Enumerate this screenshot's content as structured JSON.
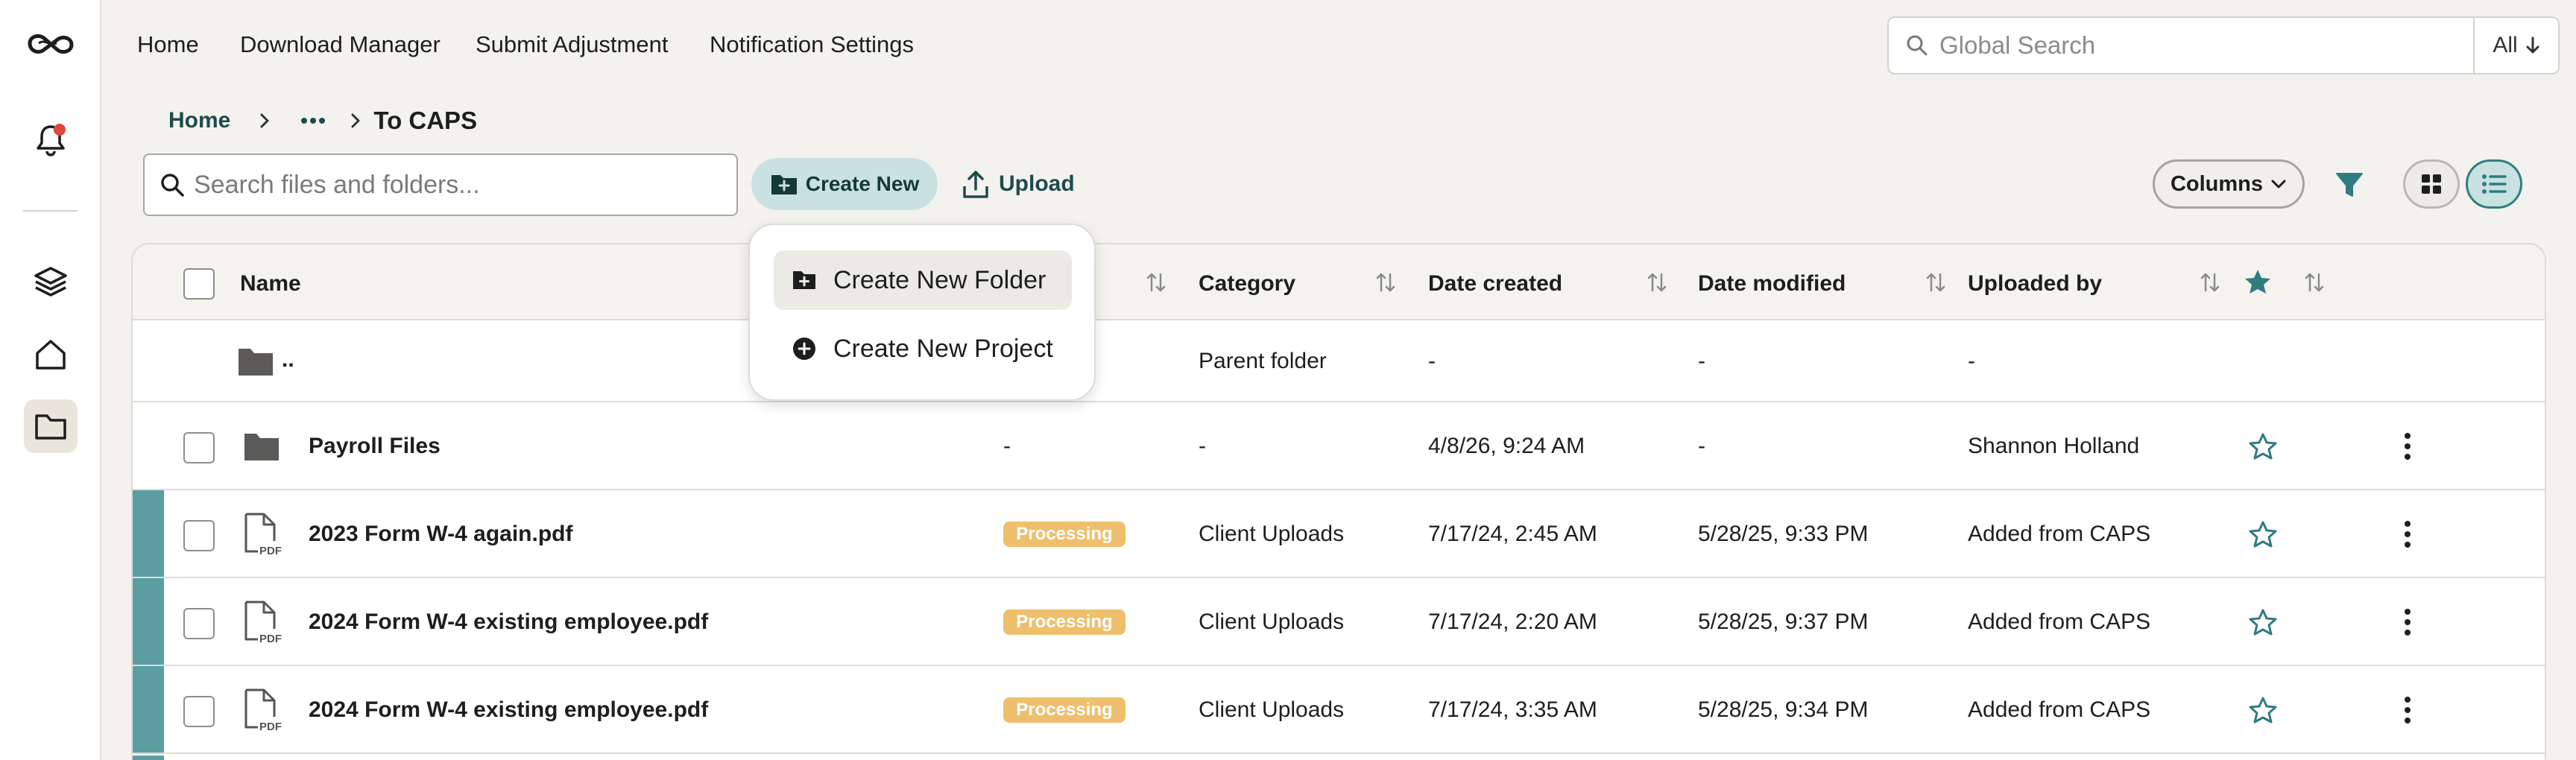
{
  "app": {
    "name": "CAPS"
  },
  "nav": {
    "items": [
      "Home",
      "Download Manager",
      "Submit Adjustment",
      "Notification Settings"
    ]
  },
  "global_search": {
    "placeholder": "Global Search",
    "scope": "All"
  },
  "breadcrumb": {
    "home": "Home",
    "current": "To CAPS"
  },
  "toolbar": {
    "search_placeholder": "Search files and folders...",
    "create_label": "Create New",
    "upload_label": "Upload",
    "columns_label": "Columns"
  },
  "create_menu": {
    "items": [
      "Create New Folder",
      "Create New Project"
    ]
  },
  "table": {
    "headers": {
      "name": "Name",
      "category": "Category",
      "created": "Date created",
      "modified": "Date modified",
      "uploaded_by": "Uploaded by"
    },
    "parent": {
      "name": "..",
      "category": "Parent folder",
      "created": "-",
      "modified": "-",
      "uploaded_by": "-"
    },
    "rows": [
      {
        "type": "folder",
        "name": "Payroll Files",
        "status": "-",
        "category": "-",
        "created": "4/8/26, 9:24 AM",
        "modified": "-",
        "uploaded_by": "Shannon Holland"
      },
      {
        "type": "pdf",
        "name": "2023 Form W-4 again.pdf",
        "status": "Processing",
        "category": "Client Uploads",
        "created": "7/17/24, 2:45 AM",
        "modified": "5/28/25, 9:33 PM",
        "uploaded_by": "Added from CAPS"
      },
      {
        "type": "pdf",
        "name": "2024 Form W-4 existing employee.pdf",
        "status": "Processing",
        "category": "Client Uploads",
        "created": "7/17/24, 2:20 AM",
        "modified": "5/28/25, 9:37 PM",
        "uploaded_by": "Added from CAPS"
      },
      {
        "type": "pdf",
        "name": "2024 Form W-4 existing employee.pdf",
        "status": "Processing",
        "category": "Client Uploads",
        "created": "7/17/24, 3:35 AM",
        "modified": "5/28/25, 9:34 PM",
        "uploaded_by": "Added from CAPS"
      }
    ]
  },
  "colors": {
    "accent": "#2e7d80",
    "accent_light": "#c9e1e1",
    "status_processing": "#eebf6d",
    "notification_dot": "#e0463a"
  },
  "icons": {
    "logo": "infinity-logo",
    "bell": "bell-icon",
    "layers": "layers-icon",
    "house": "home-icon",
    "folder": "folder-icon",
    "pdf": "pdf-file-icon",
    "star": "star-icon",
    "kebab": "more-vertical-icon",
    "filter": "filter-icon",
    "grid": "grid-view-icon",
    "list": "list-view-icon"
  }
}
